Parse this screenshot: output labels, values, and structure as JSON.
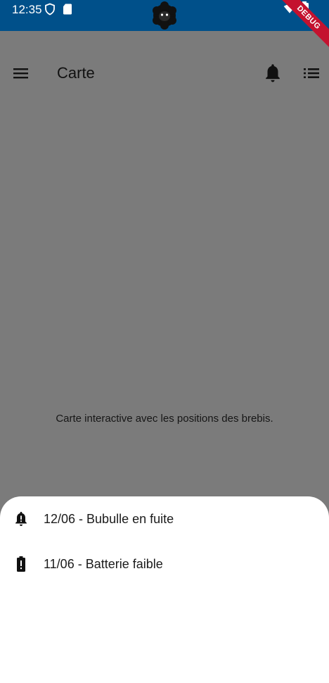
{
  "status_bar": {
    "time": "12:35",
    "debug_label": "DEBUG",
    "icons": [
      "shield-icon",
      "sd-card-icon",
      "app-logo-icon",
      "wifi-icon",
      "battery-icon"
    ]
  },
  "app_bar": {
    "title": "Carte",
    "icons": [
      "menu-icon",
      "bell-icon",
      "list-icon"
    ]
  },
  "main": {
    "map_placeholder": "Carte interactive avec les positions des brebis."
  },
  "alerts_sheet": {
    "items": [
      {
        "icon": "bell-alert-icon",
        "label": "12/06 - Bubulle en fuite"
      },
      {
        "icon": "battery-alert-icon",
        "label": "11/06 - Batterie faible"
      }
    ]
  },
  "colors": {
    "status_bar": "#00508a",
    "scrim_background": "#7b7b7b",
    "sheet_background": "#ffffff",
    "debug_banner": "#c4122f"
  }
}
